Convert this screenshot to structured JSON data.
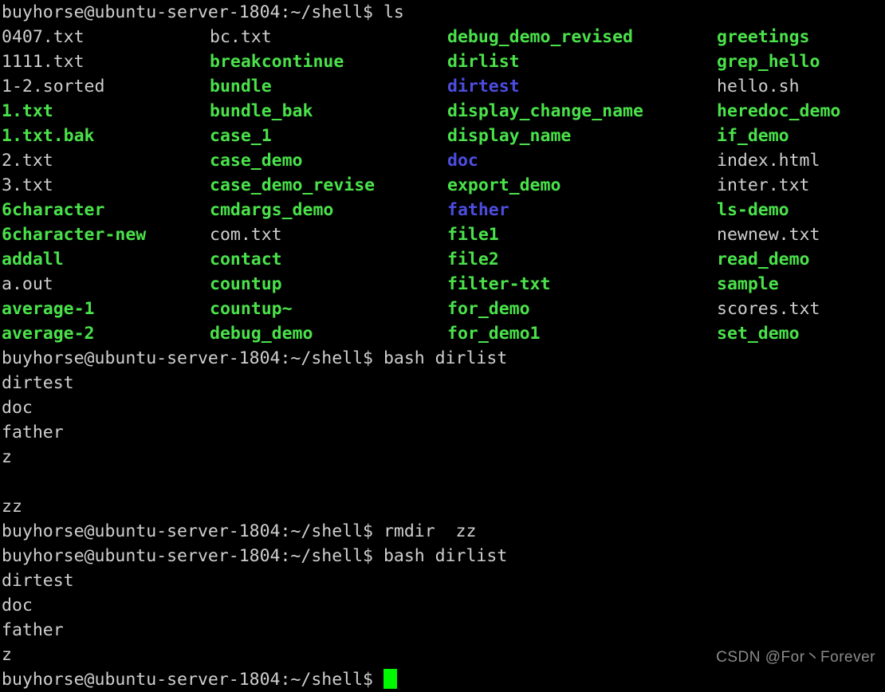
{
  "terminal": {
    "title": "buyhorse@ubuntu-server-1804: ~/shell",
    "background_color": "#000000",
    "foreground_color": "#cfcfcf",
    "color_green": "#4ae24a",
    "color_blue": "#4d4de2",
    "color_cursor": "#00f900",
    "prompt": "buyhorse@ubuntu-server-1804:~/shell$ ",
    "user": "buyhorse",
    "host": "ubuntu-server-1804",
    "cwd": "~/shell"
  },
  "commands": {
    "cmd1": "ls",
    "cmd2": "bash dirlist",
    "cmd3": "rmdir  zz",
    "cmd4": "bash dirlist"
  },
  "ls_listing": {
    "columns": 4,
    "rows": [
      [
        {
          "name": "0407.txt",
          "color": "white"
        },
        {
          "name": "bc.txt",
          "color": "white"
        },
        {
          "name": "debug_demo_revised",
          "color": "green"
        },
        {
          "name": "greetings",
          "color": "green"
        }
      ],
      [
        {
          "name": "1111.txt",
          "color": "white"
        },
        {
          "name": "breakcontinue",
          "color": "green"
        },
        {
          "name": "dirlist",
          "color": "green"
        },
        {
          "name": "grep_hello",
          "color": "green"
        }
      ],
      [
        {
          "name": "1-2.sorted",
          "color": "white"
        },
        {
          "name": "bundle",
          "color": "green"
        },
        {
          "name": "dirtest",
          "color": "blue"
        },
        {
          "name": "hello.sh",
          "color": "white"
        }
      ],
      [
        {
          "name": "1.txt",
          "color": "green"
        },
        {
          "name": "bundle_bak",
          "color": "green"
        },
        {
          "name": "display_change_name",
          "color": "green"
        },
        {
          "name": "heredoc_demo",
          "color": "green"
        }
      ],
      [
        {
          "name": "1.txt.bak",
          "color": "green"
        },
        {
          "name": "case_1",
          "color": "green"
        },
        {
          "name": "display_name",
          "color": "green"
        },
        {
          "name": "if_demo",
          "color": "green"
        }
      ],
      [
        {
          "name": "2.txt",
          "color": "white"
        },
        {
          "name": "case_demo",
          "color": "green"
        },
        {
          "name": "doc",
          "color": "blue"
        },
        {
          "name": "index.html",
          "color": "white"
        }
      ],
      [
        {
          "name": "3.txt",
          "color": "white"
        },
        {
          "name": "case_demo_revise",
          "color": "green"
        },
        {
          "name": "export_demo",
          "color": "green"
        },
        {
          "name": "inter.txt",
          "color": "white"
        }
      ],
      [
        {
          "name": "6character",
          "color": "green"
        },
        {
          "name": "cmdargs_demo",
          "color": "green"
        },
        {
          "name": "father",
          "color": "blue"
        },
        {
          "name": "ls-demo",
          "color": "green"
        }
      ],
      [
        {
          "name": "6character-new",
          "color": "green"
        },
        {
          "name": "com.txt",
          "color": "white"
        },
        {
          "name": "file1",
          "color": "green"
        },
        {
          "name": "newnew.txt",
          "color": "white"
        }
      ],
      [
        {
          "name": "addall",
          "color": "green"
        },
        {
          "name": "contact",
          "color": "green"
        },
        {
          "name": "file2",
          "color": "green"
        },
        {
          "name": "read_demo",
          "color": "green"
        }
      ],
      [
        {
          "name": "a.out",
          "color": "white"
        },
        {
          "name": "countup",
          "color": "green"
        },
        {
          "name": "filter-txt",
          "color": "green"
        },
        {
          "name": "sample",
          "color": "green"
        }
      ],
      [
        {
          "name": "average-1",
          "color": "green"
        },
        {
          "name": "countup~",
          "color": "green"
        },
        {
          "name": "for_demo",
          "color": "green"
        },
        {
          "name": "scores.txt",
          "color": "white"
        }
      ],
      [
        {
          "name": "average-2",
          "color": "green"
        },
        {
          "name": "debug_demo",
          "color": "green"
        },
        {
          "name": "for_demo1",
          "color": "green"
        },
        {
          "name": "set_demo",
          "color": "green"
        }
      ]
    ]
  },
  "output1": {
    "lines": [
      "dirtest",
      "doc",
      "father",
      "z",
      "",
      "zz"
    ]
  },
  "output2": {
    "lines": [
      "dirtest",
      "doc",
      "father",
      "z"
    ]
  },
  "watermark": {
    "text": "CSDN @For丶Forever"
  }
}
